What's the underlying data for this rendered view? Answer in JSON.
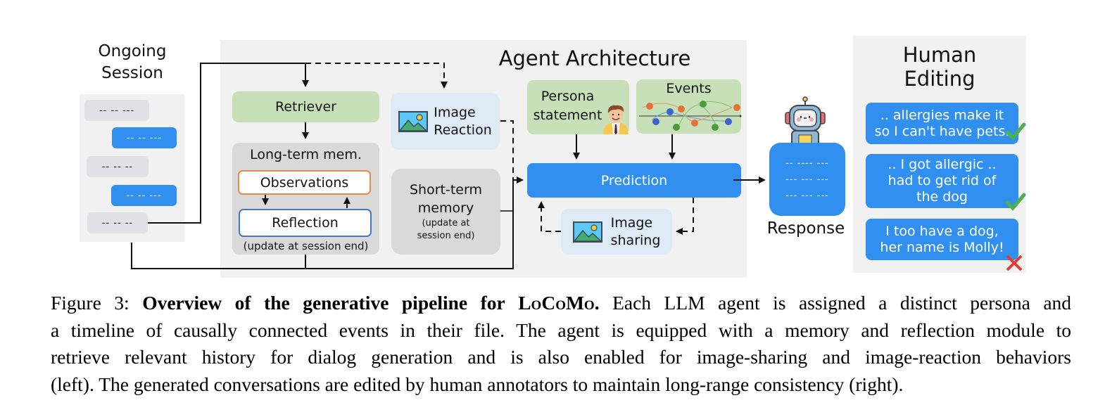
{
  "ongoing_session": {
    "title_line1": "Ongoing",
    "title_line2": "Session",
    "bubbles": [
      {
        "side": "left",
        "text": "-- -- ---"
      },
      {
        "side": "right",
        "text": "-- -- ---"
      },
      {
        "side": "left",
        "text": "-- -- --"
      },
      {
        "side": "right",
        "text": "-- -- ---"
      },
      {
        "side": "left",
        "text": "-- -- --"
      }
    ]
  },
  "agent_architecture": {
    "title": "Agent Architecture",
    "retriever": "Retriever",
    "image_reaction_line1": "Image",
    "image_reaction_line2": "Reaction",
    "long_term_memory": {
      "title": "Long-term mem.",
      "observations": "Observations",
      "reflection": "Reflection",
      "note": "(update at session end)"
    },
    "short_term_memory": {
      "line1": "Short-term",
      "line2": "memory",
      "note_line1": "(update at",
      "note_line2": "session end)"
    },
    "persona_line1": "Persona",
    "persona_line2": "statement",
    "events": "Events",
    "prediction": "Prediction",
    "image_sharing_line1": "Image",
    "image_sharing_line2": "sharing"
  },
  "response": {
    "label": "Response",
    "lines": [
      "-- ---- ---",
      "--- --- ---",
      "--- --- ---"
    ]
  },
  "human_editing": {
    "title_line1": "Human",
    "title_line2": "Editing",
    "edits": [
      {
        "lines": [
          ".. allergies make it",
          "so I can't have pets."
        ],
        "status": "accepted",
        "mark": "check-icon"
      },
      {
        "lines": [
          ".. I got allergic ..",
          "had to get rid of",
          "the dog"
        ],
        "status": "accepted",
        "mark": "check-icon"
      },
      {
        "lines": [
          "I too have a dog,",
          "her name is Molly!"
        ],
        "status": "rejected",
        "mark": "cross-icon"
      }
    ]
  },
  "colors": {
    "accent_blue": "#318ff0",
    "green_box": "#c7e0b8",
    "light_blue_box": "#deeaf6",
    "gray_box": "#d9d9d9",
    "panel_bg": "#f1f1f1",
    "observations_border": "#e88a45",
    "reflection_border": "#4477cc",
    "check_green": "#4caf50",
    "cross_red": "#e53935"
  },
  "caption": {
    "label": "Figure 3:",
    "bold_prefix": "Overview of the generative pipeline for",
    "name_sc": "LoCoMo.",
    "line1_rest": "Each LLM agent is assigned a distinct persona and",
    "line2": "a timeline of causally connected events in their file. The agent is equipped with a memory and reflection module to",
    "line3": "retrieve relevant history for dialog generation and is also enabled for image-sharing and image-reaction behaviors",
    "line4": "(left). The generated conversations are edited by human annotators to maintain long-range consistency (right)."
  }
}
